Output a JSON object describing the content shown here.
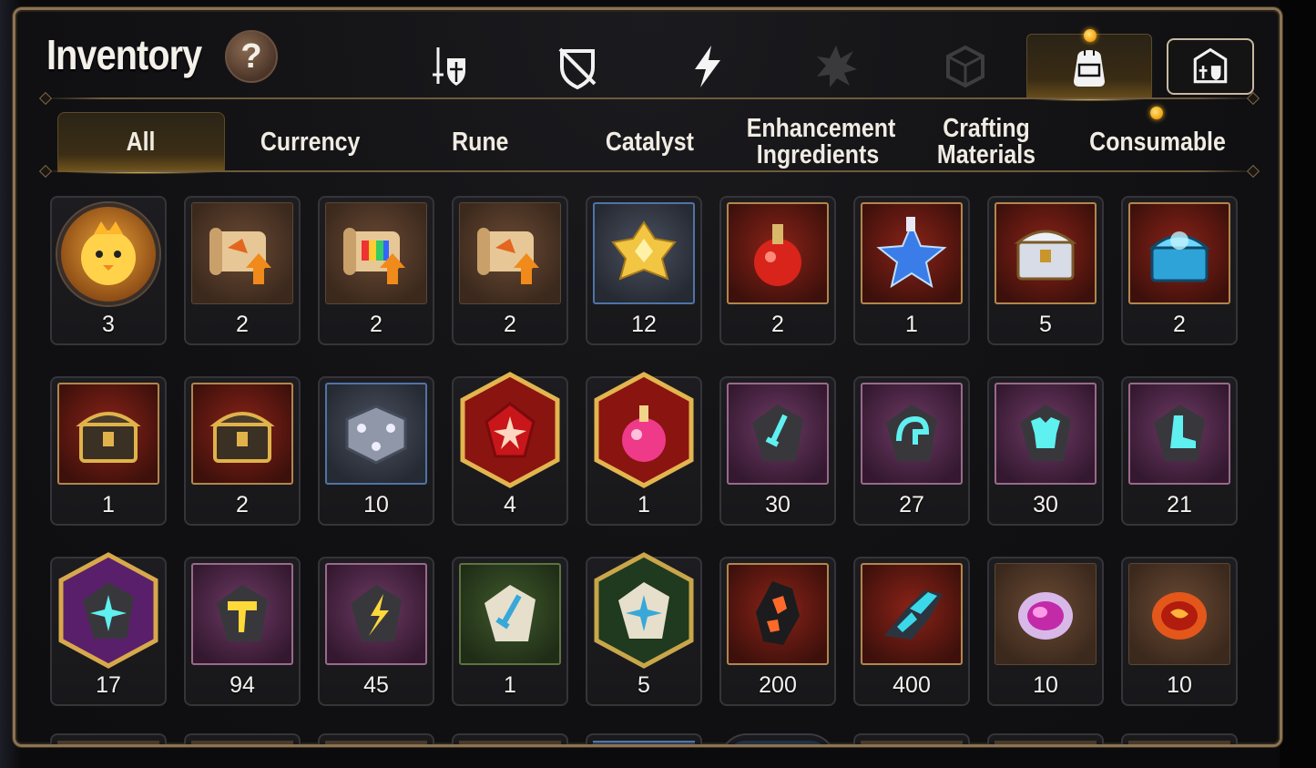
{
  "header": {
    "title": "Inventory",
    "help_label": "?"
  },
  "category_icons": [
    {
      "icon": "sword-shield-icon",
      "active": false
    },
    {
      "icon": "broken-shield-icon",
      "active": false
    },
    {
      "icon": "lightning-icon",
      "active": false
    },
    {
      "icon": "burst-icon",
      "active": false
    },
    {
      "icon": "cube-icon",
      "active": false
    },
    {
      "icon": "backpack-icon",
      "active": true,
      "badge": true
    },
    {
      "icon": "castle-icon",
      "active": false
    }
  ],
  "tabs": [
    {
      "label": "All",
      "active": true
    },
    {
      "label": "Currency",
      "active": false
    },
    {
      "label": "Rune",
      "active": false
    },
    {
      "label": "Catalyst",
      "active": false
    },
    {
      "label": "Enhancement Ingredients",
      "active": false
    },
    {
      "label": "Crafting Materials",
      "active": false
    },
    {
      "label": "Consumable",
      "active": false,
      "badge": true
    }
  ],
  "items": [
    {
      "icon": "chick-mascot-icon",
      "frame": "circle",
      "qty": "3"
    },
    {
      "icon": "scroll-upgrade-icon",
      "frame": "brown",
      "qty": "2"
    },
    {
      "icon": "rainbow-scroll-upgrade-icon",
      "frame": "brown",
      "qty": "2"
    },
    {
      "icon": "scroll-upgrade-icon",
      "frame": "brown",
      "qty": "2"
    },
    {
      "icon": "gold-crystal-cluster-icon",
      "frame": "blue",
      "qty": "12"
    },
    {
      "icon": "red-potion-icon",
      "frame": "red",
      "qty": "2"
    },
    {
      "icon": "star-bottle-icon",
      "frame": "red",
      "qty": "1"
    },
    {
      "icon": "silver-chest-icon",
      "frame": "red",
      "qty": "5"
    },
    {
      "icon": "blue-magic-chest-icon",
      "frame": "red",
      "qty": "2"
    },
    {
      "icon": "gold-chest-icon",
      "frame": "red",
      "qty": "1"
    },
    {
      "icon": "gold-chest-icon",
      "frame": "red",
      "qty": "2"
    },
    {
      "icon": "silver-dice-box-icon",
      "frame": "blue",
      "qty": "10"
    },
    {
      "icon": "red-crystal-shard-icon",
      "frame": "hex-red",
      "qty": "4"
    },
    {
      "icon": "pink-potion-icon",
      "frame": "hex-red",
      "qty": "1"
    },
    {
      "icon": "sword-rune-stone-icon",
      "frame": "purple",
      "qty": "30"
    },
    {
      "icon": "helmet-rune-stone-icon",
      "frame": "purple",
      "qty": "27"
    },
    {
      "icon": "armor-rune-stone-icon",
      "frame": "purple",
      "qty": "30"
    },
    {
      "icon": "boot-rune-stone-icon",
      "frame": "purple",
      "qty": "21"
    },
    {
      "icon": "star-rune-stone-icon",
      "frame": "hex-purple",
      "qty": "17"
    },
    {
      "icon": "hammer-rune-stone-icon",
      "frame": "purple",
      "qty": "94"
    },
    {
      "icon": "lightning-rune-stone-icon",
      "frame": "purple",
      "qty": "45"
    },
    {
      "icon": "sword-white-stone-icon",
      "frame": "green",
      "qty": "1"
    },
    {
      "icon": "star-white-stone-icon",
      "frame": "hex-green",
      "qty": "5"
    },
    {
      "icon": "lava-stone-icon",
      "frame": "red",
      "qty": "200"
    },
    {
      "icon": "teal-crystal-ore-icon",
      "frame": "red",
      "qty": "400"
    },
    {
      "icon": "purple-orb-icon",
      "frame": "brown",
      "qty": "10"
    },
    {
      "icon": "fire-orb-icon",
      "frame": "brown",
      "qty": "10"
    }
  ],
  "colors": {
    "panel_border": "#8c7352",
    "accent_gold": "#ffd36a",
    "badge": "#f0a20a",
    "frame_blue": "#4f74a6",
    "frame_purple": "#9a6a8a",
    "frame_red": "#b2864d"
  }
}
